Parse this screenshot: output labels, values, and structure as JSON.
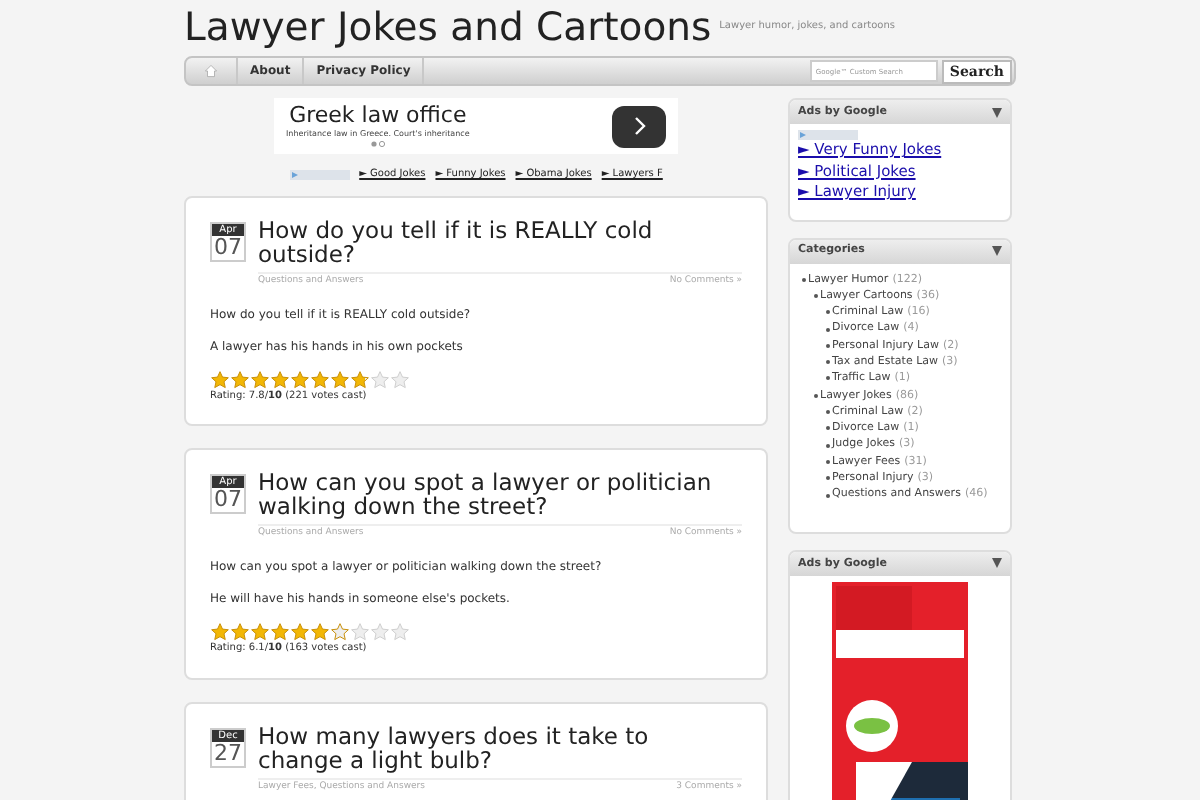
{
  "header": {
    "title": "Lawyer Jokes and Cartoons",
    "tagline": "Lawyer humor, jokes, and cartoons"
  },
  "nav": {
    "items": [
      {
        "label": "About"
      },
      {
        "label": "Privacy Policy"
      }
    ],
    "search": {
      "placeholder": "Google™ Custom Search",
      "button": "Search"
    }
  },
  "top_ad": {
    "headline": "Greek law office",
    "text": "Inheritance law in Greece. Court's inheritance",
    "links": [
      "► Good Jokes",
      "► Funny Jokes",
      "► Obama Jokes",
      "► Lawyers F"
    ]
  },
  "posts": [
    {
      "month": "Apr",
      "day": "07",
      "title": "How do you tell if it is REALLY cold outside?",
      "categories": "Questions and Answers",
      "comments": "No Comments »",
      "body": [
        "How do you tell if it is REALLY cold outside?",
        "A lawyer has his hands in his own pockets"
      ],
      "stars": 7.8,
      "rating": "Rating: 7.8/**10** (221 votes cast)"
    },
    {
      "month": "Apr",
      "day": "07",
      "title": "How can you spot a lawyer or politician walking down the street?",
      "categories": "Questions and Answers",
      "comments": "No Comments »",
      "body": [
        "How can you spot a lawyer or politician walking down the street?",
        "He will have his hands in someone else's pockets."
      ],
      "stars": 6.1,
      "rating": "Rating: 6.1/**10** (163 votes cast)"
    },
    {
      "month": "Dec",
      "day": "27",
      "title": "How many lawyers does it take to change a light bulb?",
      "categories": "Lawyer Fees, Questions and Answers",
      "comments": "3 Comments »"
    }
  ],
  "sidebar": [
    {
      "kind": "links",
      "title": "Ads by Google",
      "links": [
        "► Very Funny Jokes",
        "► Political Jokes",
        "► Lawyer Injury"
      ]
    },
    {
      "kind": "categories",
      "title": "Categories",
      "items": [
        {
          "name": "Lawyer Humor",
          "count": "(122)",
          "children": [
            {
              "name": "Lawyer Cartoons",
              "count": "(36)",
              "children": [
                {
                  "name": "Criminal Law",
                  "count": "(16)"
                },
                {
                  "name": "Divorce Law",
                  "count": "(4)"
                },
                {
                  "name": "Personal Injury Law",
                  "count": "(2)"
                },
                {
                  "name": "Tax and Estate Law",
                  "count": "(3)"
                },
                {
                  "name": "Traffic Law",
                  "count": "(1)"
                }
              ]
            },
            {
              "name": "Lawyer Jokes",
              "count": "(86)",
              "children": [
                {
                  "name": "Criminal Law",
                  "count": "(2)"
                },
                {
                  "name": "Divorce Law",
                  "count": "(1)"
                },
                {
                  "name": "Judge Jokes",
                  "count": "(3)"
                },
                {
                  "name": "Lawyer Fees",
                  "count": "(31)"
                },
                {
                  "name": "Personal Injury",
                  "count": "(3)"
                },
                {
                  "name": "Questions and Answers",
                  "count": "(46)"
                }
              ]
            }
          ]
        }
      ]
    },
    {
      "kind": "banner",
      "title": "Ads by Google"
    }
  ]
}
